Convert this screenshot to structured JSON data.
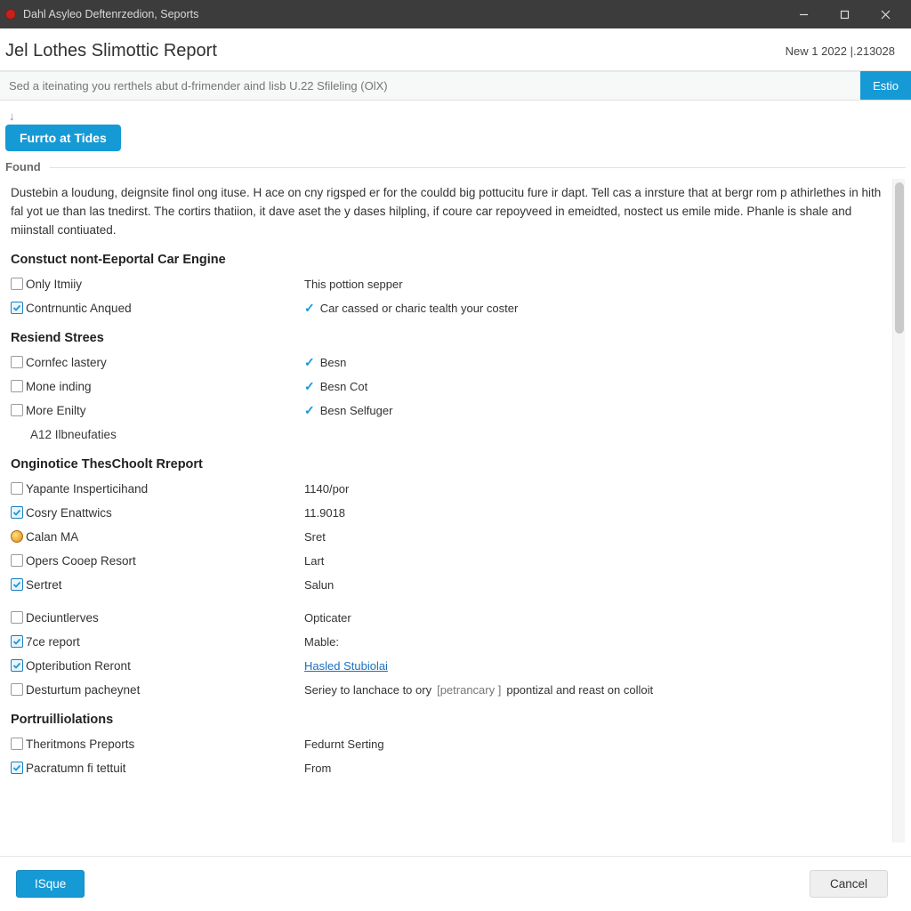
{
  "titlebar": {
    "title": "Dahl Asyleo Deftenrzedion, Seports"
  },
  "header": {
    "title": "Jel Lothes Slimottic Report",
    "date": "New 1  2022 |.213028"
  },
  "search": {
    "placeholder": "Sed a iteinating you rerthels abut d-frimender aind lisb U.22 Sfileling (OlX)",
    "edit": "Estio"
  },
  "toolbar": {
    "pill": "Furrto at Tides"
  },
  "found_label": "Found",
  "paragraph": "Dustebin a loudung, deignsite finol ong ituse. H ace on cny rigsped er for the couldd big pottucitu fure ir dapt. Tell cas a inrsture that at bergr rom p athirlethes in hith fal yot ue than las tnedirst. The cortirs thatiion, it dave aset the y dases hilpling, if coure car repoyveed in emeidted, nostect us emile mide. Phanle is shale and miinstall contiuated.",
  "sections": {
    "s1": {
      "title": "Constuct nont-Eeportal Car Engine",
      "rows": [
        {
          "checked": false,
          "label": "Only Itmiiy",
          "right_type": "text",
          "right": "This pottion sepper"
        },
        {
          "checked": true,
          "label": "Contrnuntic Anqued",
          "right_type": "tick",
          "right": "Car cassed or charic tealth your coster"
        }
      ]
    },
    "s2": {
      "title": "Resiend Strees",
      "rows": [
        {
          "checked": false,
          "label": "Cornfec lastery",
          "right_type": "tick",
          "right": "Besn"
        },
        {
          "checked": false,
          "label": "Mone inding",
          "right_type": "tick",
          "right": "Besn Cot"
        },
        {
          "checked": false,
          "label": "More Enilty",
          "right_type": "tick",
          "right": "Besn Selfuger"
        }
      ],
      "indent": "A12 Ilbneufaties"
    },
    "s3": {
      "title": "Onginotice ThesChoolt Rreport",
      "rows": [
        {
          "icon": "checkbox",
          "checked": false,
          "label": "Yapante Insperticihand",
          "right_type": "text",
          "right": "1140/por"
        },
        {
          "icon": "checkbox",
          "checked": true,
          "label": "Cosry Enattwics",
          "right_type": "text",
          "right": "11.9018"
        },
        {
          "icon": "ball",
          "label": "Calan MA",
          "right_type": "text",
          "right": "Sret"
        },
        {
          "icon": "checkbox",
          "checked": false,
          "label": "Opers Cooep Resort",
          "right_type": "text",
          "right": "Lart"
        },
        {
          "icon": "checkbox",
          "checked": true,
          "label": "Sertret",
          "right_type": "text",
          "right": "Salun"
        }
      ],
      "rows2": [
        {
          "checked": false,
          "label": "Deciuntlerves",
          "right_type": "text",
          "right": "Opticater"
        },
        {
          "checked": true,
          "label": "7ce report",
          "right_type": "text",
          "right": "Mable:"
        },
        {
          "checked": true,
          "label": "Opteribution Reront",
          "right_type": "link",
          "right": "Hasled Stubiolai"
        },
        {
          "checked": false,
          "label": "Desturtum pacheynet",
          "right_type": "bracket",
          "right_pre": "Seriey to lanchace to ory ",
          "right_bracket": "[petrancary ]",
          "right_post": " ppontizal and reast on colloit"
        }
      ]
    },
    "s4": {
      "title": "Portruilliolations",
      "rows": [
        {
          "checked": false,
          "label": "Theritmons Preports",
          "right_type": "text",
          "right": "Fedurnt Serting"
        },
        {
          "checked": true,
          "label": "Pacratumn fi tettuit",
          "right_type": "text",
          "right": "From"
        }
      ]
    }
  },
  "footer": {
    "primary": "ISque",
    "secondary": "Cancel"
  }
}
